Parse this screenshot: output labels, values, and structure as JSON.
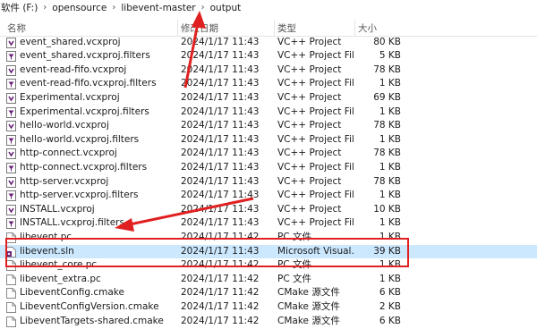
{
  "breadcrumb": [
    "软件 (F:)",
    "opensource",
    "libevent-master",
    "output"
  ],
  "columns": {
    "name": "名称",
    "date": "修改日期",
    "type": "类型",
    "size": "大小"
  },
  "files": [
    {
      "name": "event_shared.vcxproj",
      "date": "2024/1/17 11:43",
      "type": "VC++ Project",
      "size": "80 KB",
      "icon": "vcxproj-icon"
    },
    {
      "name": "event_shared.vcxproj.filters",
      "date": "2024/1/17 11:43",
      "type": "VC++ Project Fil...",
      "size": "5 KB",
      "icon": "filters-icon"
    },
    {
      "name": "event-read-fifo.vcxproj",
      "date": "2024/1/17 11:43",
      "type": "VC++ Project",
      "size": "78 KB",
      "icon": "vcxproj-icon"
    },
    {
      "name": "event-read-fifo.vcxproj.filters",
      "date": "2024/1/17 11:43",
      "type": "VC++ Project Fil...",
      "size": "1 KB",
      "icon": "filters-icon"
    },
    {
      "name": "Experimental.vcxproj",
      "date": "2024/1/17 11:43",
      "type": "VC++ Project",
      "size": "69 KB",
      "icon": "vcxproj-icon"
    },
    {
      "name": "Experimental.vcxproj.filters",
      "date": "2024/1/17 11:43",
      "type": "VC++ Project Fil...",
      "size": "1 KB",
      "icon": "filters-icon"
    },
    {
      "name": "hello-world.vcxproj",
      "date": "2024/1/17 11:43",
      "type": "VC++ Project",
      "size": "78 KB",
      "icon": "vcxproj-icon"
    },
    {
      "name": "hello-world.vcxproj.filters",
      "date": "2024/1/17 11:43",
      "type": "VC++ Project Fil...",
      "size": "1 KB",
      "icon": "filters-icon"
    },
    {
      "name": "http-connect.vcxproj",
      "date": "2024/1/17 11:43",
      "type": "VC++ Project",
      "size": "78 KB",
      "icon": "vcxproj-icon"
    },
    {
      "name": "http-connect.vcxproj.filters",
      "date": "2024/1/17 11:43",
      "type": "VC++ Project Fil...",
      "size": "1 KB",
      "icon": "filters-icon"
    },
    {
      "name": "http-server.vcxproj",
      "date": "2024/1/17 11:43",
      "type": "VC++ Project",
      "size": "78 KB",
      "icon": "vcxproj-icon"
    },
    {
      "name": "http-server.vcxproj.filters",
      "date": "2024/1/17 11:43",
      "type": "VC++ Project Fil...",
      "size": "1 KB",
      "icon": "filters-icon"
    },
    {
      "name": "INSTALL.vcxproj",
      "date": "2024/1/17 11:43",
      "type": "VC++ Project",
      "size": "10 KB",
      "icon": "vcxproj-icon"
    },
    {
      "name": "INSTALL.vcxproj.filters",
      "date": "2024/1/17 11:43",
      "type": "VC++ Project Fil...",
      "size": "1 KB",
      "icon": "filters-icon"
    },
    {
      "name": "libevent.pc",
      "date": "2024/1/17 11:42",
      "type": "PC 文件",
      "size": "1 KB",
      "icon": "file-icon"
    },
    {
      "name": "libevent.sln",
      "date": "2024/1/17 11:43",
      "type": "Microsoft Visual...",
      "size": "39 KB",
      "icon": "sln-icon",
      "selected": true
    },
    {
      "name": "libevent_core.pc",
      "date": "2024/1/17 11:42",
      "type": "PC 文件",
      "size": "1 KB",
      "icon": "file-icon"
    },
    {
      "name": "libevent_extra.pc",
      "date": "2024/1/17 11:42",
      "type": "PC 文件",
      "size": "1 KB",
      "icon": "file-icon"
    },
    {
      "name": "LibeventConfig.cmake",
      "date": "2024/1/17 11:42",
      "type": "CMake 源文件",
      "size": "6 KB",
      "icon": "file-icon"
    },
    {
      "name": "LibeventConfigVersion.cmake",
      "date": "2024/1/17 11:42",
      "type": "CMake 源文件",
      "size": "2 KB",
      "icon": "file-icon"
    },
    {
      "name": "LibeventTargets-shared.cmake",
      "date": "2024/1/17 11:42",
      "type": "CMake 源文件",
      "size": "6 KB",
      "icon": "file-icon"
    }
  ],
  "colors": {
    "annotation": "#e02020",
    "selection": "#cce8ff",
    "vcproj": "#68217a"
  }
}
